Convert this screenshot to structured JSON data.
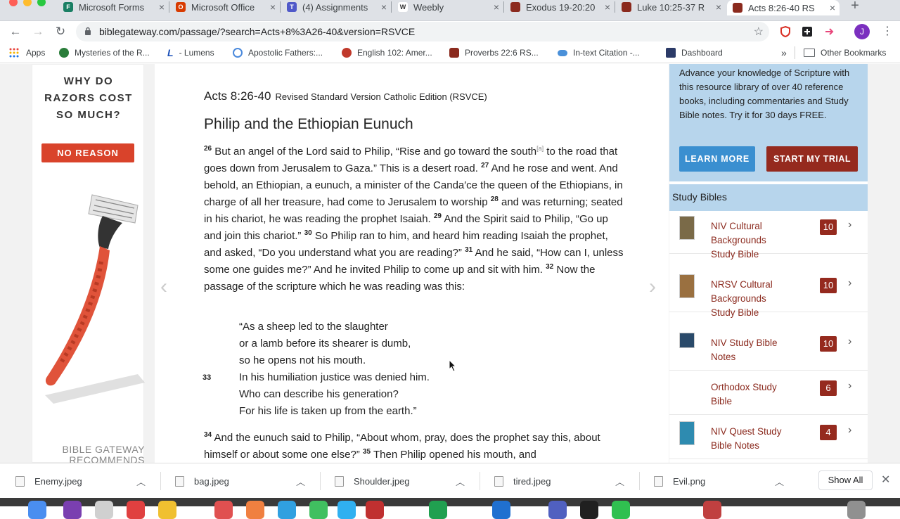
{
  "browser": {
    "tabs": [
      {
        "title": "Microsoft Forms",
        "icon_color": "#1a7f64",
        "icon": "forms-icon",
        "active": false
      },
      {
        "title": "Microsoft Office",
        "icon_color": "#d83b01",
        "icon": "office-icon",
        "active": false
      },
      {
        "title": "(4) Assignments",
        "icon_color": "#5059c9",
        "icon": "teams-icon",
        "active": false
      },
      {
        "title": "Weebly",
        "icon_color": "#333333",
        "icon": "weebly-icon",
        "active": false
      },
      {
        "title": "Exodus 19-20:20",
        "icon_color": "#8b2a1e",
        "icon": "biblegateway-icon",
        "active": false
      },
      {
        "title": "Luke 10:25-37 R",
        "icon_color": "#8b2a1e",
        "icon": "biblegateway-icon",
        "active": false
      },
      {
        "title": "Acts 8:26-40 RS",
        "icon_color": "#8b2a1e",
        "icon": "biblegateway-icon",
        "active": true
      }
    ],
    "url": "biblegateway.com/passage/?search=Acts+8%3A26-40&version=RSVCE",
    "avatar_letter": "J",
    "bookmarks": [
      {
        "label": "Apps",
        "icon": "apps-grid-icon",
        "color": "#1a73e8"
      },
      {
        "label": "Mysteries of the R...",
        "icon": "globe-icon",
        "color": "#2a7d3a"
      },
      {
        "label": "- Lumens",
        "icon": "lumens-icon",
        "color": "#1a4fb8"
      },
      {
        "label": "Apostolic Fathers:...",
        "icon": "circle-icon",
        "color": "#4a89dc"
      },
      {
        "label": "English 102: Amer...",
        "icon": "circle-icon",
        "color": "#c0392b"
      },
      {
        "label": "Proverbs 22:6 RS...",
        "icon": "biblegateway-icon",
        "color": "#8b2a1e"
      },
      {
        "label": "In-text Citation -...",
        "icon": "cloud-icon",
        "color": "#4a90d9"
      },
      {
        "label": "Dashboard",
        "icon": "dashboard-icon",
        "color": "#2b3a67"
      }
    ],
    "bookmarks_overflow": "»",
    "other_bookmarks": "Other Bookmarks"
  },
  "ad": {
    "headline": "WHY DO RAZORS COST SO MUCH?",
    "button": "NO REASON",
    "recommends": "BIBLE GATEWAY RECOMMENDS"
  },
  "passage": {
    "reference": "Acts 8:26-40",
    "version": "Revised Standard Version Catholic Edition (RSVCE)",
    "heading": "Philip and the Ethiopian Eunuch",
    "v26_a": "But an angel of the Lord said to Philip, “Rise and go toward the south",
    "footnote": "[a]",
    "v26_b": " to the road that goes down from Jerusalem to Gaza.” This is a desert road. ",
    "v27": "And he rose and went. And behold, an Ethiopian, a eunuch, a minister of the Canda′ce the queen of the Ethiopians, in charge of all her treasure, had come to Jerusalem to worship ",
    "v28": "and was returning; seated in his chariot, he was reading the prophet Isaiah. ",
    "v29": "And the Spirit said to Philip, “Go up and join this chariot.” ",
    "v30": "So Philip ran to him, and heard him reading Isaiah the prophet, and asked, “Do you understand what you are reading?” ",
    "v31": "And he said, “How can I, unless some one guides me?” And he invited Philip to come up and sit with him. ",
    "v32": "Now the passage of the scripture which he was reading was this:",
    "poem": [
      "“As a sheep led to the slaughter",
      "or a lamb before its shearer is dumb,",
      "so he opens not his mouth.",
      "In his humiliation justice was denied him.",
      "Who can describe his generation?",
      "For his life is taken up from the earth.”"
    ],
    "v34": "And the eunuch said to Philip, “About whom, pray, does the prophet say this, about himself or about some one else?” ",
    "v35": "Then Philip opened his mouth, and",
    "vnums": {
      "v26": "26",
      "v27": "27",
      "v28": "28",
      "v29": "29",
      "v30": "30",
      "v31": "31",
      "v32": "32",
      "v33": "33",
      "v34": "34",
      "v35": "35"
    }
  },
  "sidebar": {
    "promo_text": "Advance your knowledge of Scripture with this resource library of over 40 reference books, including commentaries and Study Bible notes. Try it for 30 days FREE.",
    "learn_more": "LEARN MORE",
    "start_trial": "START MY TRIAL",
    "study_bibles_heading": "Study Bibles",
    "study_bibles": [
      {
        "title": "NIV Cultural Backgrounds Study Bible",
        "count": "10",
        "cover": "#7a6a48"
      },
      {
        "title": "NRSV Cultural Backgrounds Study Bible",
        "count": "10",
        "cover": "#9a7040"
      },
      {
        "title": "NIV Study Bible Notes",
        "count": "10",
        "cover": "#2a4a6a"
      },
      {
        "title": "Orthodox Study Bible",
        "count": "6",
        "cover": "#ffffff"
      },
      {
        "title": "NIV Quest Study Bible Notes",
        "count": "4",
        "cover": "#2e8bb0"
      }
    ]
  },
  "downloads": [
    {
      "name": "Enemy.jpeg"
    },
    {
      "name": "bag.jpeg"
    },
    {
      "name": "Shoulder.jpeg"
    },
    {
      "name": "tired.jpeg"
    },
    {
      "name": "Evil.png"
    }
  ],
  "downloads_show_all": "Show All"
}
